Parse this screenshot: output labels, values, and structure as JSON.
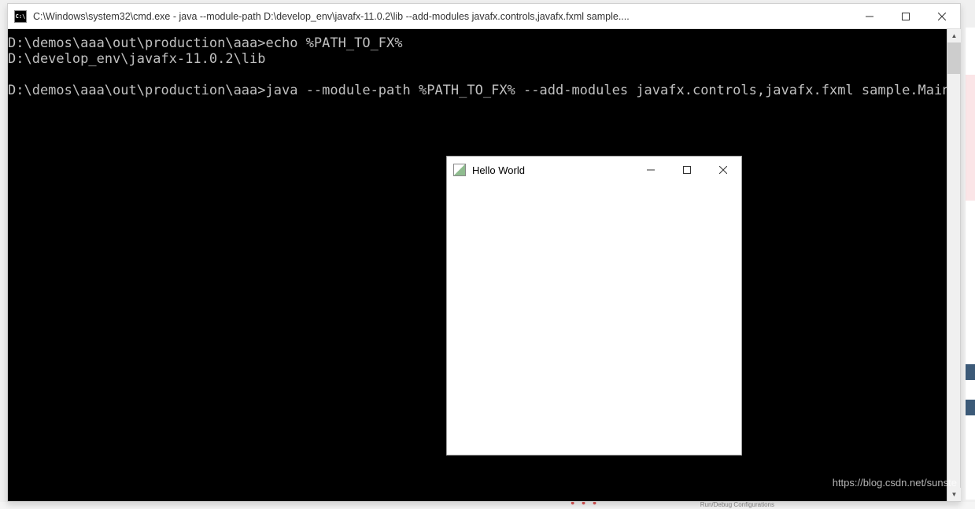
{
  "cmd": {
    "title": "C:\\Windows\\system32\\cmd.exe - java  --module-path D:\\develop_env\\javafx-11.0.2\\lib --add-modules javafx.controls,javafx.fxml sample....",
    "icon_label": "C:\\",
    "lines": {
      "l1": "D:\\demos\\aaa\\out\\production\\aaa>echo %PATH_TO_FX%",
      "l2": "D:\\develop_env\\javafx-11.0.2\\lib",
      "l3": "",
      "l4": "D:\\demos\\aaa\\out\\production\\aaa>java --module-path %PATH_TO_FX% --add-modules javafx.controls,javafx.fxml sample.Main"
    }
  },
  "hello": {
    "title": "Hello World"
  },
  "watermark": "https://blog.csdn.net/sunste",
  "bg": {
    "dots": "● ● ●",
    "label": "Run/Debug Configurations"
  }
}
